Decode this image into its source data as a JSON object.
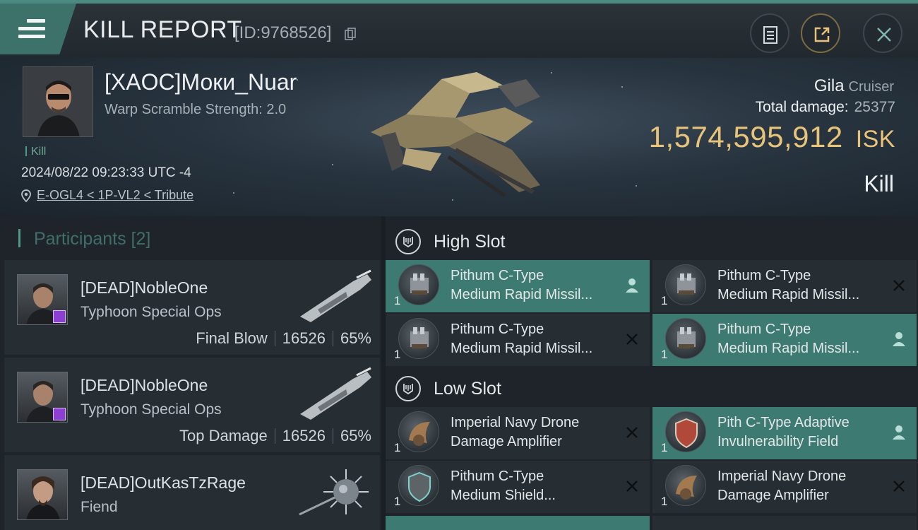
{
  "header": {
    "title": "KILL REPORT",
    "id_text": "[ID:9768526]"
  },
  "victim": {
    "name": "[XAOC]Моки_Nuar",
    "warp": "Warp Scramble Strength: 2.0",
    "tag": "Kill",
    "datetime": "2024/08/22 09:23:33 UTC -4",
    "location": "E-OGL4 < 1P-VL2 < Tribute",
    "ship_name": "Gila",
    "ship_class": "Cruiser",
    "total_damage_label": "Total damage:",
    "total_damage": "25377",
    "isk_value": "1,574,595,912",
    "isk_unit": "ISK",
    "result": "Kill"
  },
  "participants": {
    "heading": "Participants",
    "count": "[2]",
    "items": [
      {
        "name": "[DEAD]NobleOne",
        "ship": "Typhoon Special Ops",
        "role": "Final Blow",
        "damage": "16526",
        "percent": "65%"
      },
      {
        "name": "[DEAD]NobleOne",
        "ship": "Typhoon Special Ops",
        "role": "Top Damage",
        "damage": "16526",
        "percent": "65%"
      },
      {
        "name": "[DEAD]OutKasTzRage",
        "ship": "Fiend"
      }
    ]
  },
  "slots": {
    "high": {
      "label": "High Slot",
      "modules": [
        {
          "line1": "Pithum C-Type",
          "line2": "Medium Rapid Missil...",
          "qty": "1",
          "state": "person",
          "highlight": true
        },
        {
          "line1": "Pithum C-Type",
          "line2": "Medium Rapid Missil...",
          "qty": "1",
          "state": "destroyed",
          "highlight": false
        },
        {
          "line1": "Pithum C-Type",
          "line2": "Medium Rapid Missil...",
          "qty": "1",
          "state": "destroyed",
          "highlight": false
        },
        {
          "line1": "Pithum C-Type",
          "line2": "Medium Rapid Missil...",
          "qty": "1",
          "state": "person",
          "highlight": true
        }
      ]
    },
    "low": {
      "label": "Low Slot",
      "modules": [
        {
          "line1": "Imperial Navy Drone",
          "line2": "Damage Amplifier",
          "qty": "1",
          "state": "destroyed",
          "highlight": false
        },
        {
          "line1": "Pith C-Type Adaptive",
          "line2": "Invulnerability Field",
          "qty": "1",
          "state": "person",
          "highlight": true
        },
        {
          "line1": "Pithum C-Type",
          "line2": "Medium Shield...",
          "qty": "1",
          "state": "destroyed",
          "highlight": false
        },
        {
          "line1": "Imperial Navy Drone",
          "line2": "Damage Amplifier",
          "qty": "1",
          "state": "destroyed",
          "highlight": false
        }
      ]
    }
  },
  "colors": {
    "accent": "#3d7a72",
    "isk": "#e8c47a",
    "purple_badge": "#8d3fd2"
  },
  "icons": [
    "menu-icon",
    "copy-icon",
    "clipboard-icon",
    "share-icon",
    "close-icon",
    "location-pin-icon",
    "slot-icon",
    "person-icon",
    "x-icon"
  ]
}
